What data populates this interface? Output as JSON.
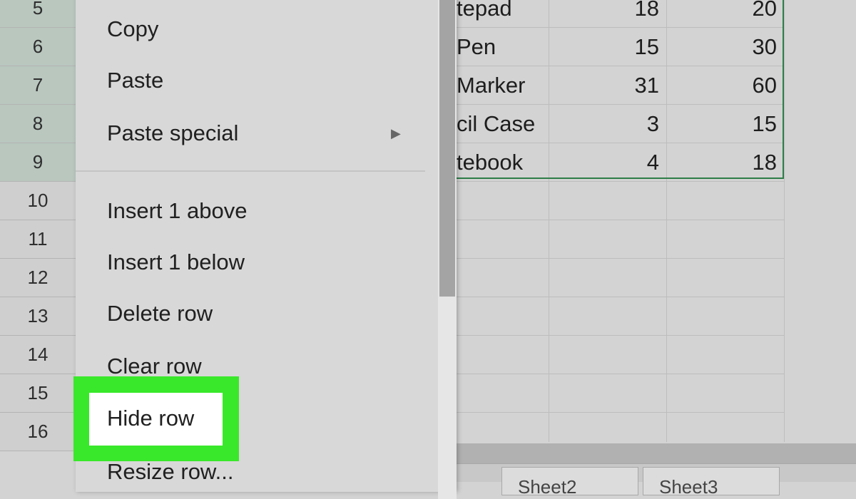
{
  "row_numbers": [
    "5",
    "6",
    "7",
    "8",
    "9",
    "10",
    "11",
    "12",
    "13",
    "14",
    "15",
    "16"
  ],
  "grid_rows": [
    {
      "item": "tepad",
      "col2": "18",
      "col3": "20"
    },
    {
      "item": "Pen",
      "col2": "15",
      "col3": "30"
    },
    {
      "item": "Marker",
      "col2": "31",
      "col3": "60"
    },
    {
      "item": "cil Case",
      "col2": "3",
      "col3": "15"
    },
    {
      "item": "tebook",
      "col2": "4",
      "col3": "18"
    }
  ],
  "context_menu": {
    "items": [
      "Copy",
      "Paste",
      "Paste special",
      "Insert 1 above",
      "Insert 1 below",
      "Delete row",
      "Clear row",
      "Hide row",
      "Resize row..."
    ]
  },
  "sheet_tabs": [
    "Sheet2",
    "Sheet3"
  ],
  "colors": {
    "highlight": "#39e82a",
    "selection_border": "#2e7d48",
    "row_selected": "#b9c7bf"
  }
}
